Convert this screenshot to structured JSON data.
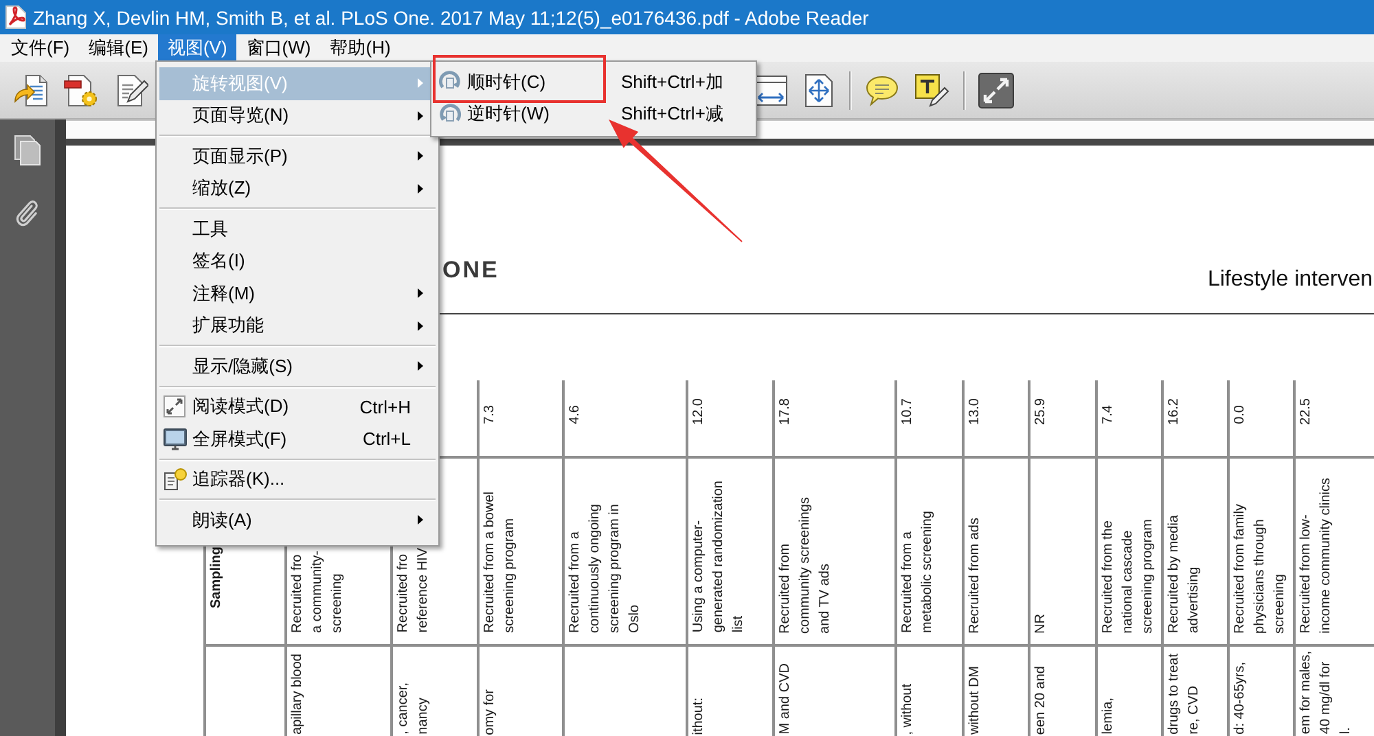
{
  "window": {
    "title": "Zhang X, Devlin HM, Smith B, et al. PLoS One. 2017 May 11;12(5)_e0176436.pdf - Adobe Reader"
  },
  "menu_bar": [
    {
      "label": "文件(F)",
      "selected": false
    },
    {
      "label": "编辑(E)",
      "selected": false
    },
    {
      "label": "视图(V)",
      "selected": true
    },
    {
      "label": "窗口(W)",
      "selected": false
    },
    {
      "label": "帮助(H)",
      "selected": false
    }
  ],
  "view_menu": [
    {
      "kind": "item",
      "label": "旋转视图(V)",
      "selected": true,
      "submenu": true
    },
    {
      "kind": "item",
      "label": "页面导览(N)",
      "selected": false,
      "submenu": true
    },
    {
      "kind": "separator"
    },
    {
      "kind": "item",
      "label": "页面显示(P)",
      "selected": false,
      "submenu": true
    },
    {
      "kind": "item",
      "label": "缩放(Z)",
      "selected": false,
      "submenu": true
    },
    {
      "kind": "separator"
    },
    {
      "kind": "item",
      "label": "工具",
      "selected": false,
      "submenu": false
    },
    {
      "kind": "item",
      "label": "签名(I)",
      "selected": false,
      "submenu": false
    },
    {
      "kind": "item",
      "label": "注释(M)",
      "selected": false,
      "submenu": true
    },
    {
      "kind": "item",
      "label": "扩展功能",
      "selected": false,
      "submenu": true
    },
    {
      "kind": "separator"
    },
    {
      "kind": "item",
      "label": "显示/隐藏(S)",
      "selected": false,
      "submenu": true
    },
    {
      "kind": "separator"
    },
    {
      "kind": "item",
      "label": "阅读模式(D)",
      "shortcut": "Ctrl+H",
      "selected": false,
      "submenu": false
    },
    {
      "kind": "item",
      "label": "全屏模式(F)",
      "shortcut": "Ctrl+L",
      "selected": false,
      "submenu": false
    },
    {
      "kind": "separator"
    },
    {
      "kind": "item",
      "label": "追踪器(K)...",
      "selected": false,
      "submenu": false
    },
    {
      "kind": "separator"
    },
    {
      "kind": "item",
      "label": "朗读(A)",
      "selected": false,
      "submenu": true
    }
  ],
  "rotate_submenu": [
    {
      "label": "顺时针(C)",
      "shortcut": "Shift+Ctrl+加",
      "selected": false
    },
    {
      "label": "逆时针(W)",
      "shortcut": "Shift+Ctrl+减",
      "selected": false
    }
  ],
  "document": {
    "logo": "ONE",
    "running_title": "Lifestyle interven",
    "table": {
      "rows": [
        {
          "cells": [
            null,
            null,
            null,
            "7.3",
            "4.6",
            "12.0",
            "17.8",
            "10.7",
            "13.0",
            "25.9",
            "7.4",
            "16.2",
            "0.0",
            "22.5"
          ]
        },
        {
          "cells": [
            "Sampling",
            "Recruited fro\na community-\nscreening",
            "Recruited fro\nreference HIV",
            "Recruited from a bowel\nscreening program",
            "Recruited from a\ncontinuously ongoing\nscreening program in\nOslo",
            "Using a computer-\ngenerated randomization\nlist",
            "Recruited from\ncommunity screenings\nand TV ads",
            "Recruited from a\nmetabolic screening",
            "Recruited from ads",
            "NR",
            "Recruited from the\nnational cascade\nscreening program",
            "Recruited by media\nadvertising",
            "Recruited from family\nphysicians through\nscreening",
            "Recruited from low-\nincome community clinics"
          ]
        },
        {
          "cells": [
            null,
            "apillary blood",
            ", cancer,\nnancy",
            "omy for",
            null,
            "ithout:",
            "M and CVD",
            ", without",
            "without DM",
            "een 20 and",
            "lemia,",
            "drugs to treat\nre, CVD",
            "d: 40-65yrs,",
            "em for males,\n40 mg/dl for\nl."
          ]
        }
      ]
    }
  }
}
